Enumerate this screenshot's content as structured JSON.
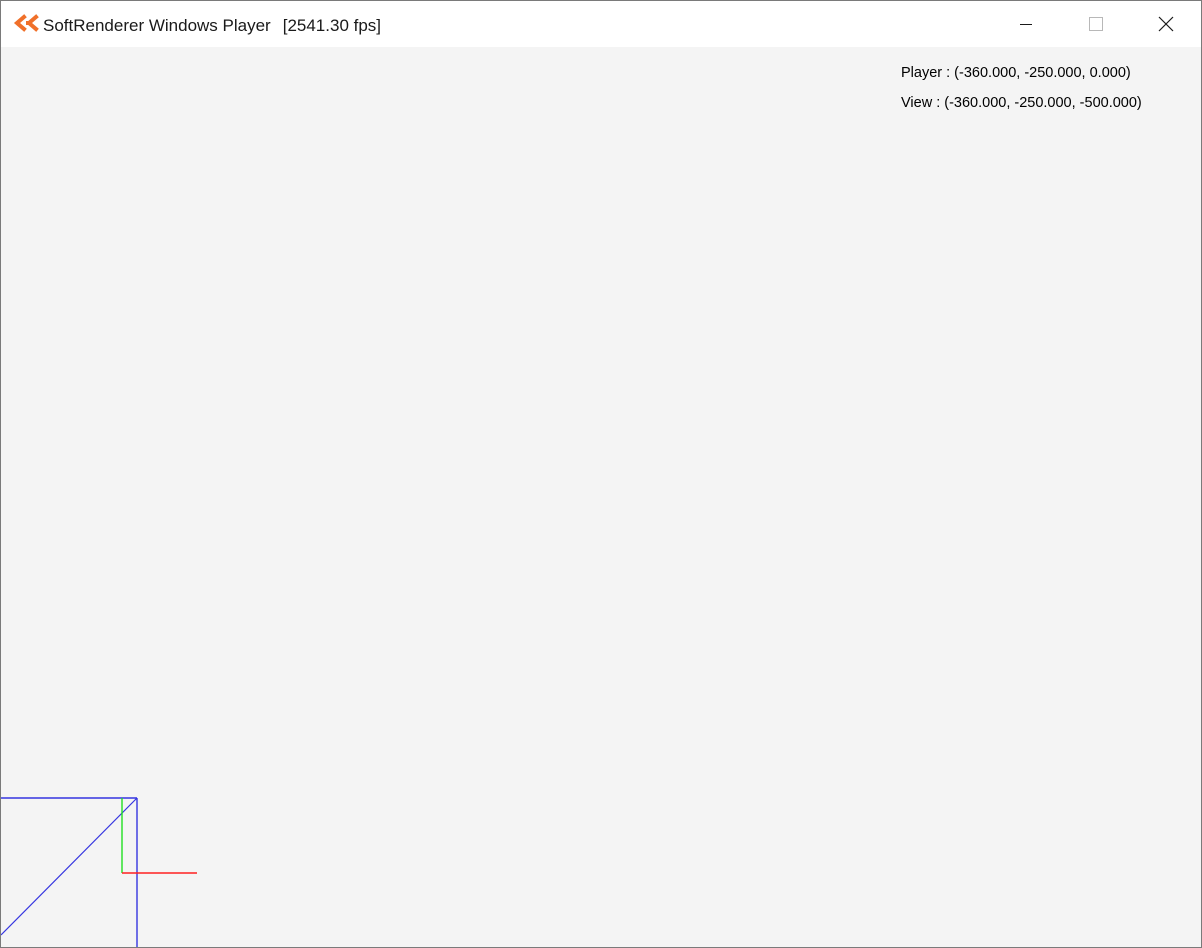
{
  "window": {
    "title": "SoftRenderer Windows Player",
    "fps": "[2541.30 fps]",
    "icon": "ck-logo-icon",
    "accent_color": "#f0702a",
    "controls": {
      "minimize_icon": "minimize-icon",
      "maximize_icon": "maximize-icon",
      "close_icon": "close-icon"
    }
  },
  "viewport": {
    "background_color": "#f4f4f4",
    "overlay": {
      "player": "Player : (-360.000, -250.000, 0.000)",
      "view": "View : (-360.000, -250.000, -500.000)"
    },
    "scene_colors": {
      "grid_line": "#3535e0",
      "x_axis": "#ff2020",
      "y_axis": "#20e020"
    }
  }
}
